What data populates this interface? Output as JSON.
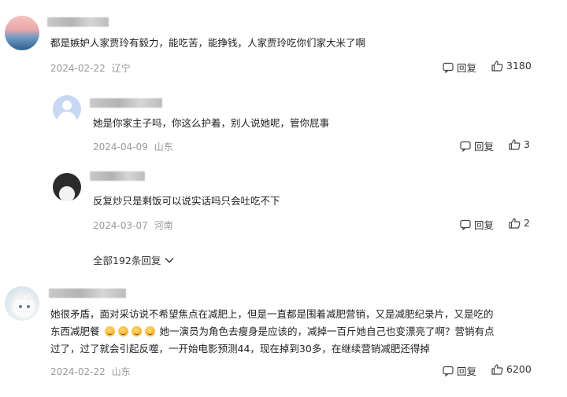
{
  "comments": [
    {
      "text": "都是嫉妒人家贾玲有毅力，能吃苦，能挣钱，人家贾玲吃你们家大米了啊",
      "date": "2024-02-22",
      "location": "辽宁",
      "reply_label": "回复",
      "likes": "3180",
      "avatar_colors": [
        "#f3b0a8",
        "#7aa6c9",
        "#3c6e98"
      ]
    },
    {
      "text": "她是你家主子吗，你这么护着，别人说她呢，管你屁事",
      "date": "2024-04-09",
      "location": "山东",
      "reply_label": "回复",
      "likes": "3",
      "avatar_colors": [
        "#c7d6f0",
        "#ffffff"
      ]
    },
    {
      "text": "反复炒只是剩饭可以说实话吗只会吐吃不下",
      "date": "2024-03-07",
      "location": "河南",
      "reply_label": "回复",
      "likes": "2",
      "avatar_colors": [
        "#2a2a2a",
        "#f2f2f2"
      ]
    },
    {
      "text_line1": "她很矛盾，面对采访说不希望焦点在减肥上，但是一直都是围着减肥营销，又是减肥纪录片，又是吃的",
      "text_line2_a": "东西减肥餐",
      "text_line2_b": "她一演员为角色去瘦身是应该的，减掉一百斤她自己也变漂亮了啊？营销有点",
      "text_line3": "过了，过了就会引起反噬，一开始电影预测44，现在掉到30多，在继续营销减肥还得掉",
      "date": "2024-02-22",
      "location": "山东",
      "reply_label": "回复",
      "likes": "6200",
      "avatar_colors": [
        "#cfe0e8",
        "#f7f7f7"
      ]
    }
  ],
  "more_replies_label": "全部192条回复"
}
